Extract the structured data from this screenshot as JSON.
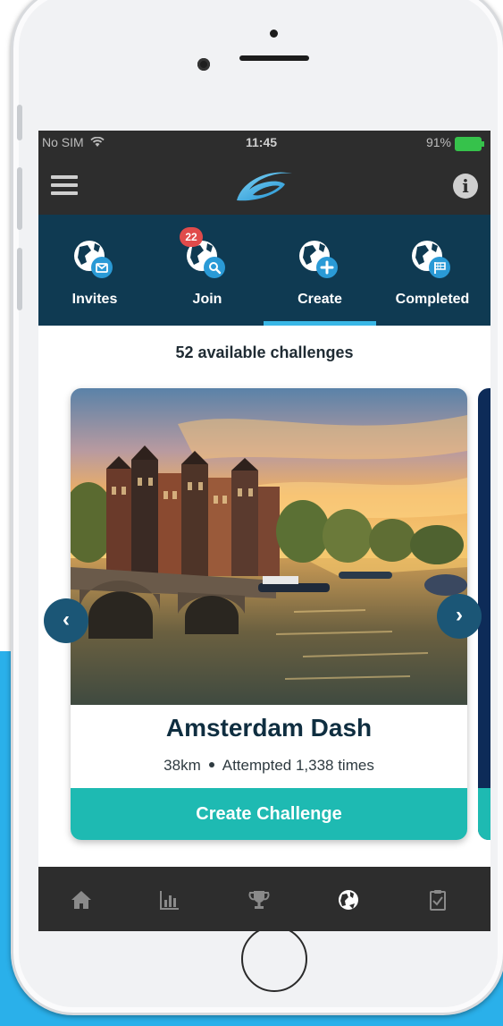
{
  "status_bar": {
    "carrier": "No SIM",
    "time": "11:45",
    "battery": "91%"
  },
  "top_tabs": [
    {
      "label": "Invites",
      "badge": "",
      "icon": "globe-envelope-icon"
    },
    {
      "label": "Join",
      "badge": "22",
      "icon": "globe-search-icon"
    },
    {
      "label": "Create",
      "badge": "",
      "icon": "globe-plus-icon",
      "active": true
    },
    {
      "label": "Completed",
      "badge": "",
      "icon": "globe-flag-icon"
    }
  ],
  "available_text": "52 available challenges",
  "card": {
    "title": "Amsterdam Dash",
    "distance": "38km",
    "attempts": "Attempted 1,338 times",
    "cta": "Create Challenge",
    "image": "amsterdam-canal-sunset"
  },
  "bottom_tabs": [
    "home-icon",
    "stats-icon",
    "trophy-icon",
    "globe-icon",
    "clipboard-check-icon"
  ],
  "colors": {
    "navbar": "#2d2d2d",
    "tabs_bg": "#0f3a52",
    "accent_blue": "#39b7e6",
    "cta_teal": "#1ebab2",
    "badge_red": "#e04b4b"
  }
}
